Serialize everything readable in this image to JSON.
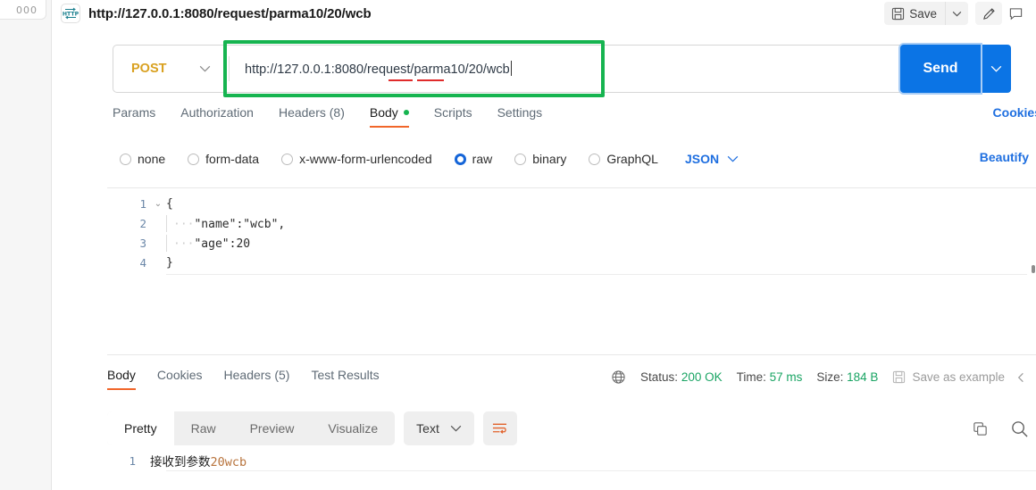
{
  "rail": {
    "menu_glyph": "000"
  },
  "header": {
    "protocol_badge": "HTTP",
    "request_title": "http://127.0.0.1:8080/request/parma10/20/wcb",
    "save_label": "Save"
  },
  "request_bar": {
    "method": "POST",
    "url": "http://127.0.0.1:8080/request/parma10/20/wcb",
    "send_label": "Send"
  },
  "request_tabs": {
    "items": [
      {
        "label": "Params"
      },
      {
        "label": "Authorization"
      },
      {
        "label": "Headers (8)"
      },
      {
        "label": "Body"
      },
      {
        "label": "Scripts"
      },
      {
        "label": "Settings"
      }
    ],
    "active": "Body",
    "cookies_link": "Cookies"
  },
  "body_options": {
    "radios": [
      {
        "label": "none",
        "selected": false
      },
      {
        "label": "form-data",
        "selected": false
      },
      {
        "label": "x-www-form-urlencoded",
        "selected": false
      },
      {
        "label": "raw",
        "selected": true
      },
      {
        "label": "binary",
        "selected": false
      },
      {
        "label": "GraphQL",
        "selected": false
      }
    ],
    "format": "JSON",
    "beautify_label": "Beautify"
  },
  "editor": {
    "lines": [
      {
        "n": "1",
        "text": "{"
      },
      {
        "n": "2",
        "text": "\"name\":\"wcb\","
      },
      {
        "n": "3",
        "text": "\"age\":20"
      },
      {
        "n": "4",
        "text": "}"
      }
    ]
  },
  "response_tabs": {
    "items": [
      {
        "label": "Body"
      },
      {
        "label": "Cookies"
      },
      {
        "label": "Headers (5)"
      },
      {
        "label": "Test Results"
      }
    ],
    "active": "Body"
  },
  "response_meta": {
    "status_label": "Status:",
    "status_value": "200 OK",
    "time_label": "Time:",
    "time_value": "57 ms",
    "size_label": "Size:",
    "size_value": "184 B",
    "save_example_label": "Save as example"
  },
  "response_toolbar": {
    "segments": [
      {
        "label": "Pretty"
      },
      {
        "label": "Raw"
      },
      {
        "label": "Preview"
      },
      {
        "label": "Visualize"
      }
    ],
    "active": "Pretty",
    "format": "Text"
  },
  "response_body": {
    "line_number": "1",
    "text_cn": "接收到参数",
    "text_value": "20wcb"
  },
  "colors": {
    "accent_blue": "#0b74e5",
    "accent_orange": "#f1662a",
    "annotation_green": "#16b450",
    "method_amber": "#d9a121",
    "status_green": "#19a463"
  }
}
